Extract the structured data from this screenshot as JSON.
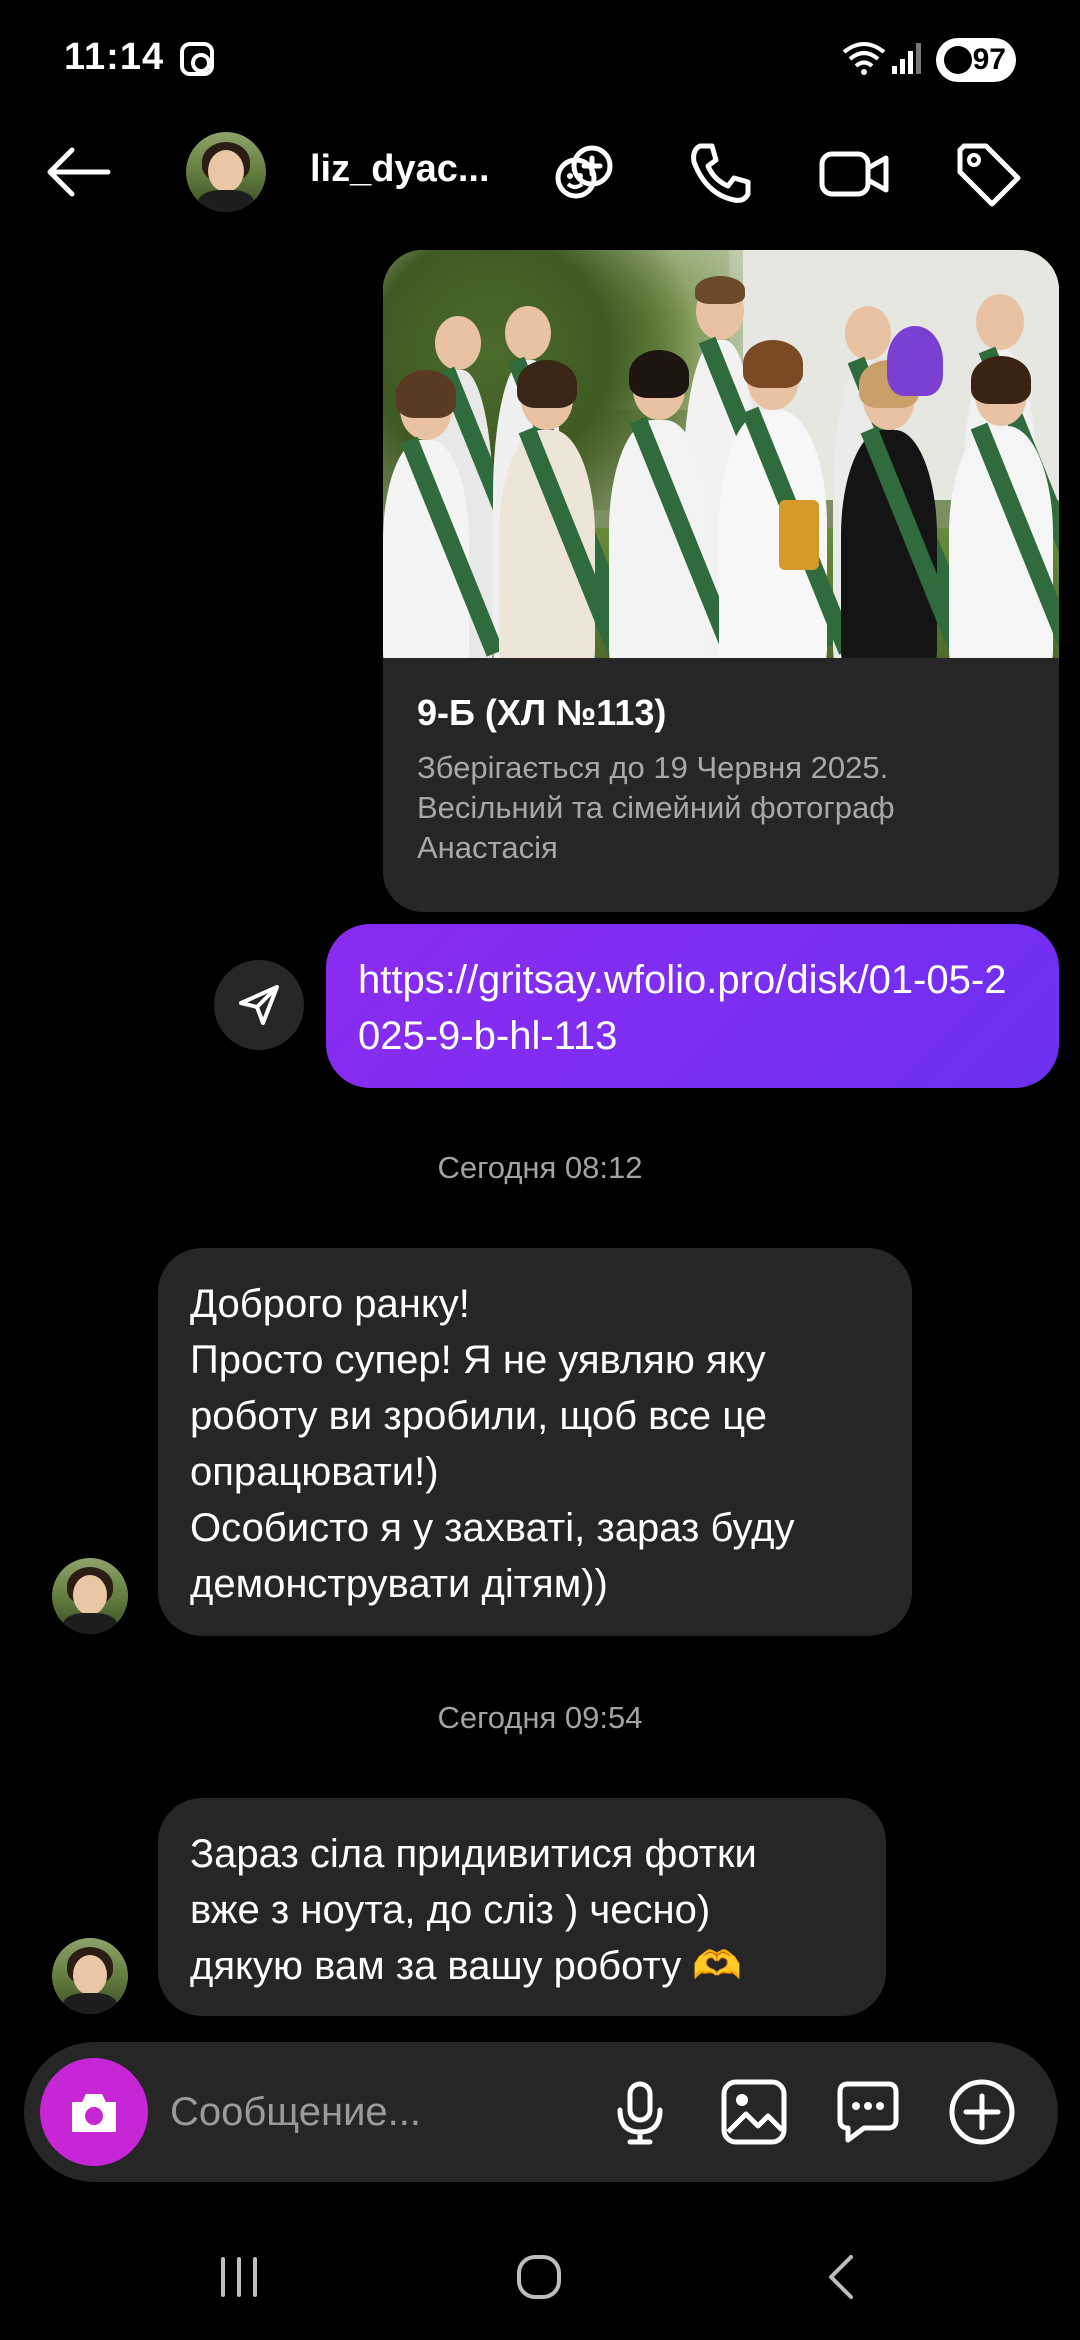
{
  "status_bar": {
    "time": "11:14",
    "battery": "97",
    "icons": [
      "instagram-icon",
      "wifi-icon",
      "signal-icon",
      "battery-icon"
    ]
  },
  "header": {
    "username": "liz_dyac...",
    "icons": [
      "back-arrow-icon",
      "add-people-icon",
      "phone-icon",
      "video-icon",
      "tag-icon"
    ]
  },
  "link_card": {
    "title": "9-Б (ХЛ №113)",
    "description": "Зберігається до 19 Червня 2025. Весільний та сімейний фотограф Анастасія"
  },
  "sent_link": {
    "text": "https://gritsay.wfolio.pro/disk/01-05-2025-9-b-hl-113"
  },
  "timestamps": [
    "Сегодня 08:12",
    "Сегодня 09:54"
  ],
  "messages": [
    {
      "lines": [
        "Доброго ранку!",
        "Просто супер! Я не уявляю яку",
        "роботу ви зробили, щоб все це",
        "опрацювати!)",
        "Особисто я у захваті, зараз буду",
        "демонструвати дітям))"
      ]
    },
    {
      "lines": [
        "Зараз сіла придивитися фотки",
        "вже з ноута, до сліз ) чесно)",
        "дякую вам за вашу роботу 🫶"
      ]
    }
  ],
  "composer": {
    "placeholder": "Сообщение...",
    "accent_color": "#c726d6",
    "icons": [
      "camera-icon",
      "microphone-icon",
      "gallery-icon",
      "sticker-icon",
      "plus-icon"
    ]
  },
  "colors": {
    "sent_bubble": "#7a2ef2",
    "received_bubble": "#262626",
    "background": "#000000"
  }
}
